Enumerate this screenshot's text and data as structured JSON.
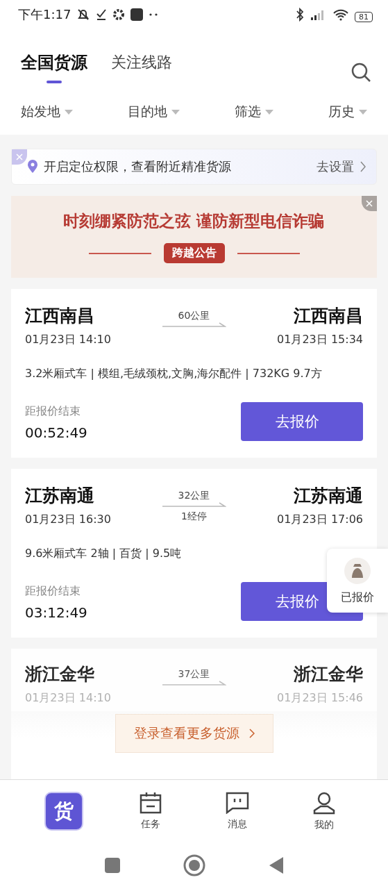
{
  "status_bar": {
    "time": "下午1:17",
    "battery": "81"
  },
  "tabs": [
    {
      "label": "全国货源",
      "selected": true
    },
    {
      "label": "关注线路",
      "selected": false
    }
  ],
  "filters": [
    {
      "label": "始发地"
    },
    {
      "label": "目的地"
    },
    {
      "label": "筛选"
    },
    {
      "label": "历史"
    }
  ],
  "location_tip": {
    "text": "开启定位权限，查看附近精准货源",
    "action": "去设置"
  },
  "banner": {
    "headline": "时刻绷紧防范之弦 谨防新型电信诈骗",
    "tag": "跨越公告"
  },
  "cargo": [
    {
      "from": "江西南昌",
      "to": "江西南昌",
      "distance": "60公里",
      "depart": "01月23日 14:10",
      "arrive": "01月23日 15:34",
      "details": "3.2米厢式车 | 模组,毛绒颈枕,文胸,海尔配件 | 732KG 9.7方",
      "countdown_label": "距报价结束",
      "countdown": "00:52:49",
      "button": "去报价"
    },
    {
      "from": "江苏南通",
      "to": "江苏南通",
      "distance": "32公里",
      "stops": "1经停",
      "depart": "01月23日 16:30",
      "arrive": "01月23日 17:06",
      "details": "9.6米厢式车  2轴 | 百货 | 9.5吨",
      "countdown_label": "距报价结束",
      "countdown": "03:12:49",
      "button": "去报价"
    },
    {
      "from": "浙江金华",
      "to": "浙江金华",
      "distance": "37公里",
      "depart": "01月23日 14:10",
      "arrive": "01月23日 15:46"
    }
  ],
  "quoted_badge": "已报价",
  "login_more": "登录查看更多货源",
  "bottom_nav": [
    {
      "label": "货",
      "kind": "logo",
      "selected": true
    },
    {
      "label": "任务",
      "kind": "task",
      "selected": false
    },
    {
      "label": "消息",
      "kind": "message",
      "selected": false
    },
    {
      "label": "我的",
      "kind": "profile",
      "selected": false
    }
  ]
}
